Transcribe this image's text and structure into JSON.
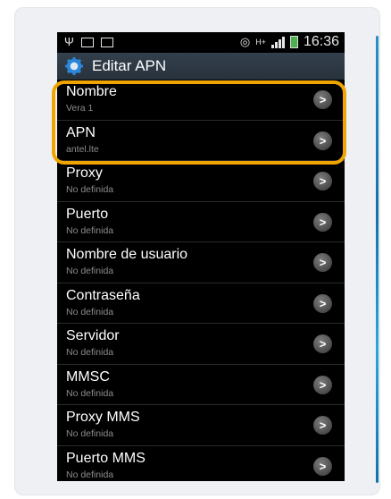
{
  "statusbar": {
    "time": "16:36",
    "icons": [
      "usb-icon",
      "screenshot-icon",
      "email-icon",
      "eye-icon",
      "network-h-plus-icon",
      "signal-icon",
      "battery-icon"
    ]
  },
  "actionbar": {
    "title": "Editar APN",
    "icon": "gear-icon"
  },
  "items": [
    {
      "title": "Nombre",
      "value": "Vera 1"
    },
    {
      "title": "APN",
      "value": "antel.lte"
    },
    {
      "title": "Proxy",
      "value": "No definida"
    },
    {
      "title": "Puerto",
      "value": "No definida"
    },
    {
      "title": "Nombre de usuario",
      "value": "No definida"
    },
    {
      "title": "Contraseña",
      "value": "No definida"
    },
    {
      "title": "Servidor",
      "value": "No definida"
    },
    {
      "title": "MMSC",
      "value": "No definida"
    },
    {
      "title": "Proxy MMS",
      "value": "No definida"
    },
    {
      "title": "Puerto MMS",
      "value": "No definida"
    }
  ],
  "colors": {
    "highlight": "#f0a400",
    "actionbar": "#2e3a45",
    "list_bg": "#000000"
  }
}
